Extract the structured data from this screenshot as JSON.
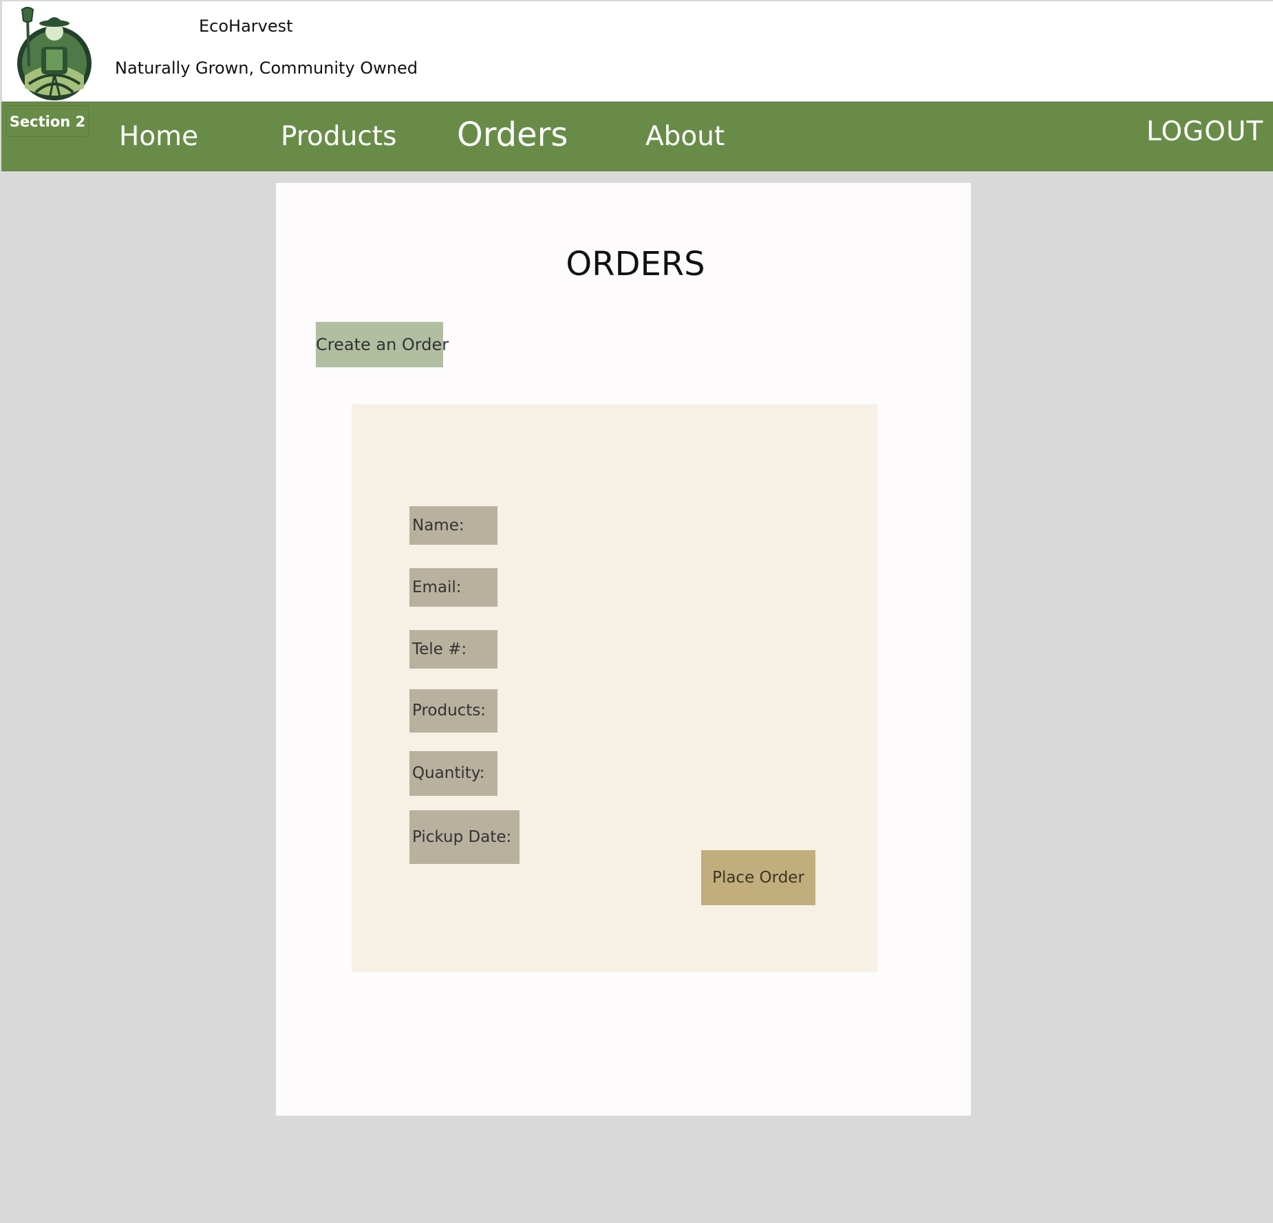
{
  "header": {
    "brand_name": "EcoHarvest",
    "tagline": "Naturally Grown, Community Owned",
    "logo_icon": "farmer-logo-icon"
  },
  "navbar": {
    "section_tag": "Section 2",
    "items": [
      {
        "label": "Home"
      },
      {
        "label": "Products"
      },
      {
        "label": "Orders",
        "active": true
      },
      {
        "label": "About"
      }
    ],
    "logout_label": "LOGOUT"
  },
  "main": {
    "title": "ORDERS",
    "create_button_label": "Create an Order",
    "form": {
      "fields": [
        {
          "label": "Name:"
        },
        {
          "label": "Email:"
        },
        {
          "label": "Tele #:"
        },
        {
          "label": "Products:"
        },
        {
          "label": "Quantity:"
        },
        {
          "label": "Pickup Date:"
        }
      ],
      "submit_label": "Place Order"
    }
  },
  "colors": {
    "nav_green": "#688c48",
    "page_background": "#d9d9d9",
    "card_background": "#fdfbfb",
    "form_panel": "#f6f0e5",
    "field_label": "#b8b19d",
    "create_button": "#b1bea0",
    "place_order_button": "#c2ae7c"
  }
}
